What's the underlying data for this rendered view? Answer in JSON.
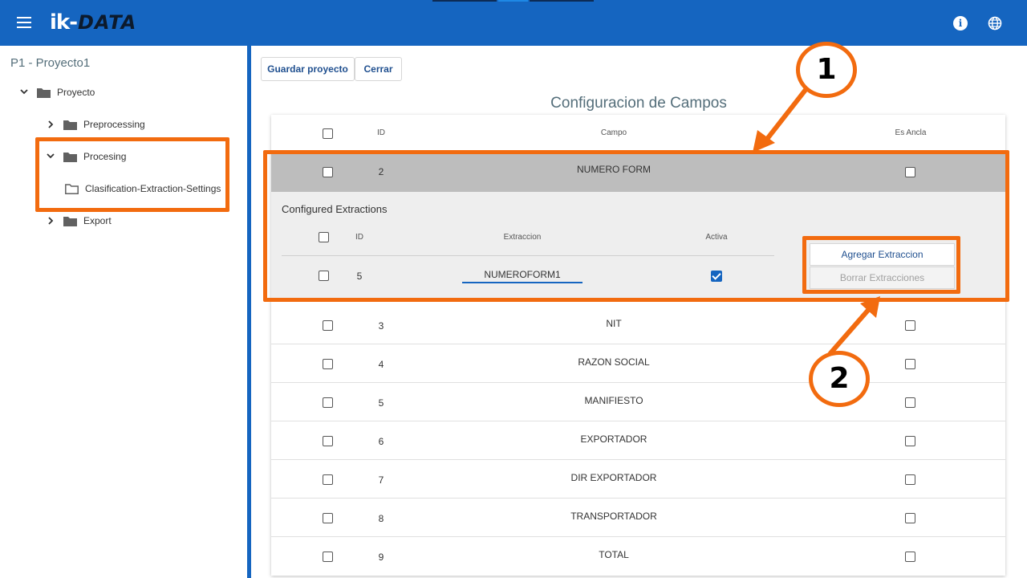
{
  "header": {
    "brand_prefix": "ik-",
    "brand_suffix": "DATA",
    "icons": [
      "menu-icon",
      "info-icon",
      "globe-icon"
    ],
    "info_glyph": "i",
    "accent_color": "#1565c0"
  },
  "sidebar": {
    "project_title": "P1 - Proyecto1",
    "tree": {
      "root": "Proyecto",
      "items": [
        {
          "label": "Preprocessing",
          "expanded": false
        },
        {
          "label": "Procesing",
          "expanded": true,
          "children": [
            "Clasification-Extraction-Settings"
          ]
        },
        {
          "label": "Export",
          "expanded": false
        }
      ]
    }
  },
  "toolbar": {
    "save_label": "Guardar proyecto",
    "close_label": "Cerrar"
  },
  "main": {
    "title": "Configuracion de Campos",
    "columns": {
      "select": "",
      "id": "ID",
      "campo": "Campo",
      "ancla": "Es Ancla"
    },
    "expanded_row": {
      "id": "2",
      "campo": "NUMERO FORM",
      "es_ancla": false
    },
    "sub_panel": {
      "title": "Configured Extractions",
      "columns": {
        "id": "ID",
        "extraccion": "Extraccion",
        "activa": "Activa"
      },
      "rows": [
        {
          "id": "5",
          "extraccion": "NUMEROFORM1",
          "activa": true
        }
      ],
      "add_label": "Agregar Extraccion",
      "delete_label": "Borrar Extracciones"
    },
    "rows": [
      {
        "id": "3",
        "campo": "NIT",
        "es_ancla": false
      },
      {
        "id": "4",
        "campo": "RAZON SOCIAL",
        "es_ancla": false
      },
      {
        "id": "5",
        "campo": "MANIFIESTO",
        "es_ancla": false
      },
      {
        "id": "6",
        "campo": "EXPORTADOR",
        "es_ancla": false
      },
      {
        "id": "7",
        "campo": "DIR EXPORTADOR",
        "es_ancla": false
      },
      {
        "id": "8",
        "campo": "TRANSPORTADOR",
        "es_ancla": false
      },
      {
        "id": "9",
        "campo": "TOTAL",
        "es_ancla": false
      }
    ]
  },
  "annotations": {
    "badge_1": "1",
    "badge_2": "2",
    "color": "#f26b0f"
  }
}
